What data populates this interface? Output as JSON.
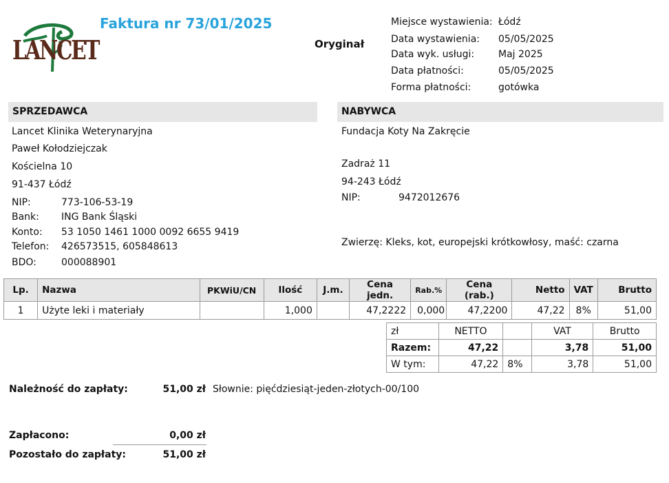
{
  "logo": {
    "text": "LANCET"
  },
  "invoice": {
    "title": "Faktura nr 73/01/2025",
    "copy": "Oryginał"
  },
  "meta": [
    {
      "label": "Miejsce wystawienia:",
      "value": "Łódź"
    },
    {
      "label": "Data wystawienia:",
      "value": "05/05/2025"
    },
    {
      "label": "Data wyk. usługi:",
      "value": "Maj 2025"
    },
    {
      "label": "Data płatności:",
      "value": "05/05/2025"
    },
    {
      "label": "Forma płatności:",
      "value": "gotówka"
    }
  ],
  "seller": {
    "header": "SPRZEDAWCA",
    "name": "Lancet Klinika Weterynaryjna",
    "person": "Paweł Kołodziejczak",
    "street": "Kościelna 10",
    "city": "91-437 Łódź",
    "fields": [
      {
        "label": "NIP:",
        "value": "773-106-53-19"
      },
      {
        "label": "Bank:",
        "value": "ING Bank Śląski"
      },
      {
        "label": "Konto:",
        "value": "53 1050 1461 1000 0092 6655 9419"
      },
      {
        "label": "Telefon:",
        "value": "426573515,  605848613"
      },
      {
        "label": "BDO:",
        "value": "000088901"
      }
    ]
  },
  "buyer": {
    "header": "NABYWCA",
    "name": "Fundacja Koty Na Zakręcie",
    "street": "Zadraż 11",
    "city": "94-243 Łódź",
    "nip_label": "NIP:",
    "nip": "9472012676",
    "animal": "Zwierzę: Kleks, kot, europejski krótkowłosy, maść: czarna"
  },
  "items_table": {
    "headers": [
      "Lp.",
      "Nazwa",
      "PKWiU/CN",
      "Ilość",
      "J.m.",
      "Cena jedn.",
      "Rab.%",
      "Cena (rab.)",
      "Netto",
      "VAT",
      "Brutto"
    ],
    "rows": [
      {
        "lp": "1",
        "name": "Użyte leki i materiały",
        "pkwiu": "",
        "qty": "1,000",
        "unit": "",
        "price": "47,2222",
        "discount": "0,000",
        "price_disc": "47,2200",
        "net": "47,22",
        "vat": "8%",
        "gross": "51,00"
      }
    ]
  },
  "summary": {
    "currency": "zł",
    "net_label": "NETTO",
    "vat_label": "VAT",
    "gross_label": "Brutto",
    "total_label": "Razem:",
    "total_net": "47,22",
    "total_vat": "3,78",
    "total_gross": "51,00",
    "of_which_label": "W tym:",
    "of_which_net": "47,22",
    "of_which_rate": "8%",
    "of_which_vat": "3,78",
    "of_which_gross": "51,00"
  },
  "payment": {
    "due_label": "Należność do zapłaty:",
    "due_amount": "51,00 zł",
    "in_words": "Słownie: pięćdziesiąt-jeden-złotych-00/100",
    "paid_label": "Zapłacono:",
    "paid_amount": "0,00 zł",
    "remaining_label": "Pozostało do zapłaty:",
    "remaining_amount": "51,00 zł"
  },
  "colors": {
    "title": "#29a3dc",
    "logo_text": "#5a2a1a",
    "logo_snake": "#1e7a3c",
    "header_bg": "#e6e6e6"
  }
}
